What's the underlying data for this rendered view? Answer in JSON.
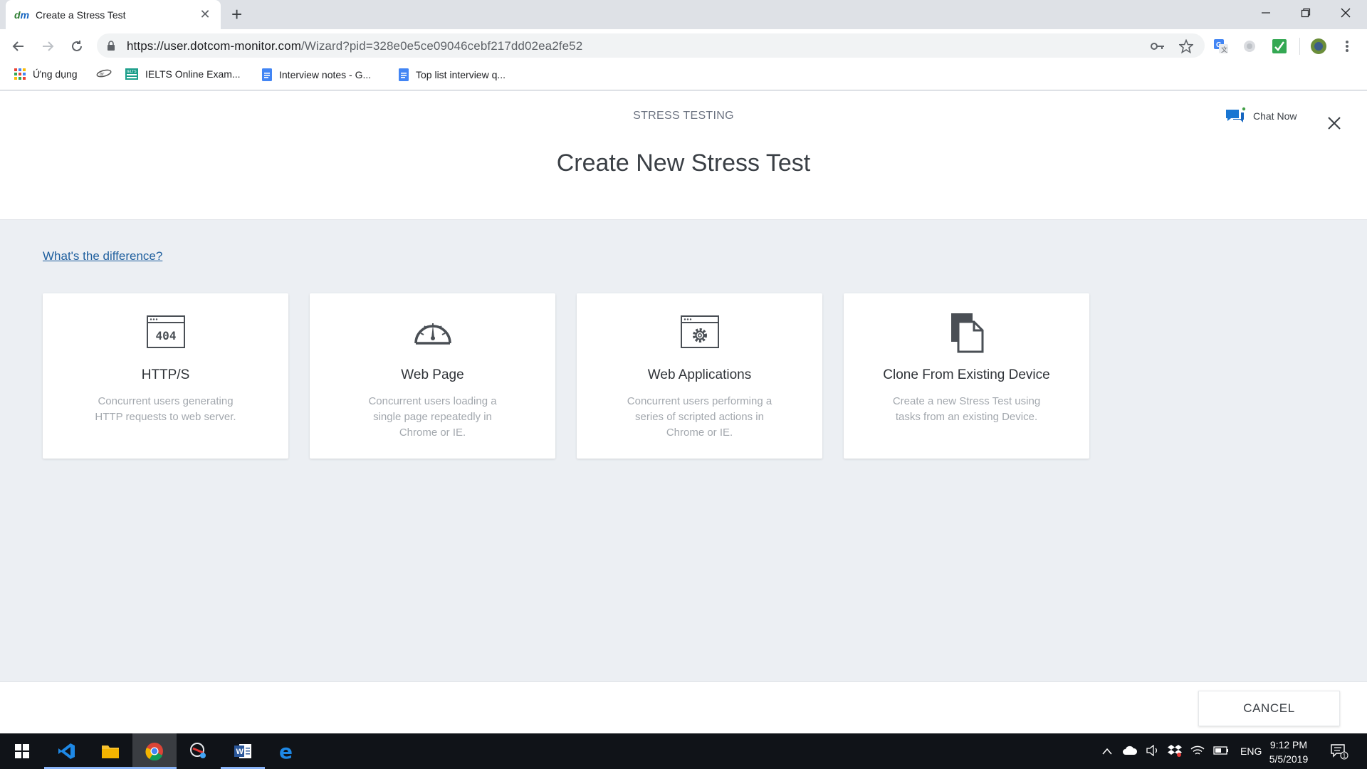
{
  "browser": {
    "tab_title": "Create a Stress Test",
    "url_host": "https://user.dotcom-monitor.com",
    "url_path": "/Wizard?pid=328e0e5ce09046cebf217dd02ea2fe52"
  },
  "bookmarks": [
    {
      "label": "Ứng dụng",
      "icon": "apps-grid-icon"
    },
    {
      "label": "",
      "icon": "bookmark-logo-icon"
    },
    {
      "label": "IELTS Online Exam...",
      "icon": "ielts-icon"
    },
    {
      "label": "Interview notes - G...",
      "icon": "google-docs-icon"
    },
    {
      "label": "Top list interview q...",
      "icon": "google-docs-icon"
    }
  ],
  "header": {
    "eyebrow": "STRESS TESTING",
    "title": "Create New Stress Test",
    "chat_label": "Chat Now"
  },
  "main": {
    "difference_link": "What's the difference?",
    "cards": [
      {
        "title": "HTTP/S",
        "description": "Concurrent users generating HTTP requests to web server.",
        "icon": "http-404-icon"
      },
      {
        "title": "Web Page",
        "description": "Concurrent users loading a single page repeatedly in Chrome or IE.",
        "icon": "speedometer-icon"
      },
      {
        "title": "Web Applications",
        "description": "Concurrent users performing a series of scripted actions in Chrome or IE.",
        "icon": "browser-gear-icon"
      },
      {
        "title": "Clone From Existing Device",
        "description": "Create a new Stress Test using tasks from an existing Device.",
        "icon": "copy-document-icon"
      }
    ]
  },
  "footer": {
    "cancel_label": "CANCEL"
  },
  "taskbar": {
    "language": "ENG",
    "time": "9:12 PM",
    "date": "5/5/2019",
    "notification_count": "1"
  },
  "colors": {
    "link": "#1f5f9e",
    "page_bg": "#eceff3",
    "chat_icon": "#1976d2"
  }
}
